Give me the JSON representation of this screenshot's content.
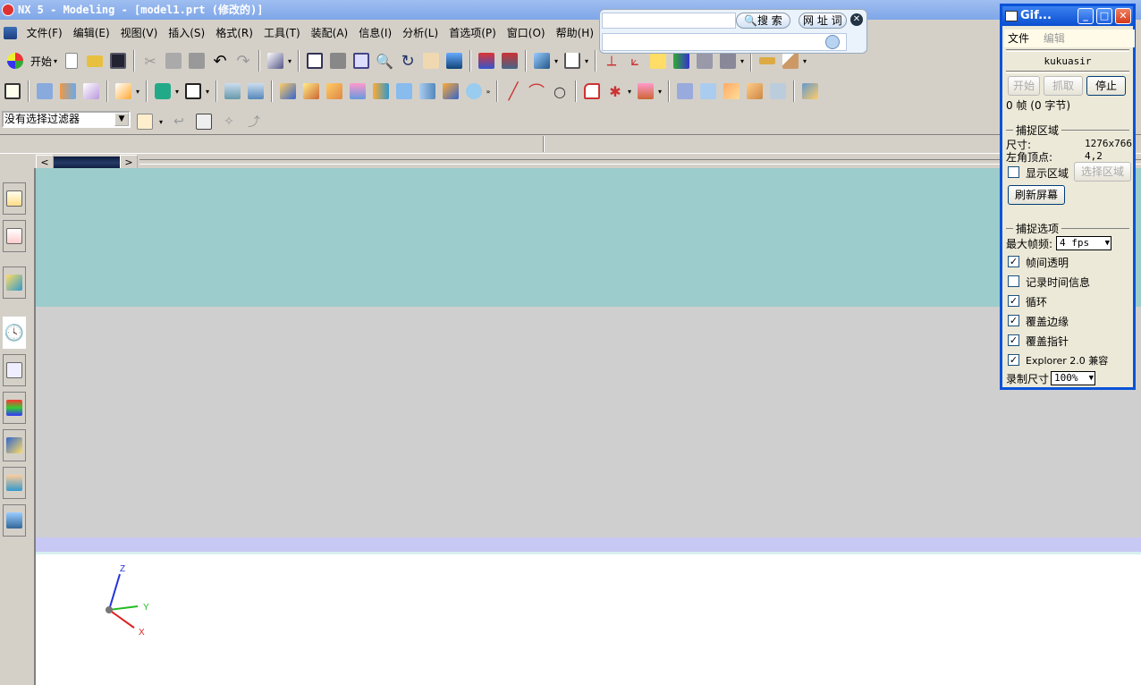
{
  "window": {
    "title": "NX 5 - Modeling - [model1.prt (修改的)]"
  },
  "menubar": [
    "文件(F)",
    "编辑(E)",
    "视图(V)",
    "插入(S)",
    "格式(R)",
    "工具(T)",
    "装配(A)",
    "信息(I)",
    "分析(L)",
    "首选项(P)",
    "窗口(O)",
    "帮助(H)"
  ],
  "toolbar": {
    "start_label": "开始"
  },
  "selection_filter": {
    "value": "没有选择过滤器"
  },
  "search_bar": {
    "search_label": "搜 索",
    "url_label": "网 址",
    "word_label": "词"
  },
  "triad": {
    "x": "X",
    "y": "Y",
    "z": "Z"
  },
  "gif_recorder": {
    "title": "Gif...",
    "menu": {
      "file": "文件",
      "edit": "编辑"
    },
    "username": "kukuasir",
    "buttons": {
      "start": "开始",
      "capture": "抓取",
      "stop": "停止"
    },
    "frames_status": "0 帧 (0 字节)",
    "capture_region": {
      "label": "捕捉区域",
      "size_label": "尺寸:",
      "size_value": "1276x766",
      "corner_label": "左角顶点:",
      "corner_value": "4,2",
      "show_region_label": "显示区域",
      "select_region_button": "选择区域",
      "refresh_button": "刷新屏幕"
    },
    "capture_options": {
      "label": "捕捉选项",
      "max_fps_label": "最大帧频:",
      "max_fps_value": "4 fps",
      "options": [
        {
          "label": "帧间透明",
          "checked": true
        },
        {
          "label": "记录时间信息",
          "checked": false
        },
        {
          "label": "循环",
          "checked": true
        },
        {
          "label": "覆盖边缘",
          "checked": true
        },
        {
          "label": "覆盖指针",
          "checked": true
        },
        {
          "label": "Explorer 2.0 兼容",
          "checked": true
        }
      ],
      "record_size_label": "录制尺寸",
      "record_size_value": "100%"
    }
  },
  "colors": {
    "viewport_teal": "#9dcccc",
    "viewport_gray": "#cfcfcf",
    "viewport_lavender": "#c8c8f4",
    "titlebar_blue": "#0a4fd0"
  }
}
